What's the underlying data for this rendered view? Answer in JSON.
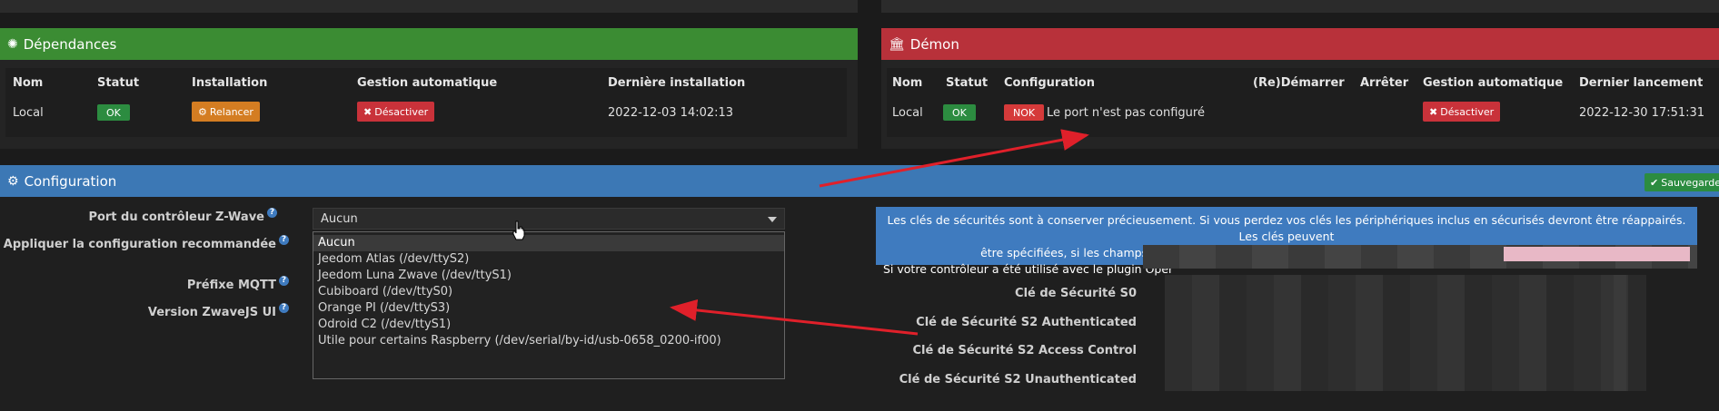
{
  "deps": {
    "title": "Dépendances",
    "headers": [
      "Nom",
      "Statut",
      "Installation",
      "Gestion automatique",
      "Dernière installation"
    ],
    "row": {
      "name": "Local",
      "status": "OK",
      "install_btn": "Relancer",
      "auto_btn": "Désactiver",
      "last": "2022-12-03 14:02:13"
    }
  },
  "daemon": {
    "title": "Démon",
    "headers": [
      "Nom",
      "Statut",
      "Configuration",
      "(Re)Démarrer",
      "Arrêter",
      "Gestion automatique",
      "Dernier lancement"
    ],
    "row": {
      "name": "Local",
      "status": "OK",
      "config_badge": "NOK",
      "config_text": "Le port n'est pas configuré",
      "auto_btn": "Désactiver",
      "last": "2022-12-30 17:51:31"
    }
  },
  "config": {
    "title": "Configuration",
    "save": "Sauvegarder",
    "labels": {
      "port": "Port du contrôleur Z-Wave",
      "apply": "Appliquer la configuration recommandée",
      "mqtt": "Préfixe MQTT",
      "zwavejs": "Version ZwaveJS UI"
    },
    "select_value": "Aucun",
    "options": [
      "Aucun",
      "Jeedom Atlas (/dev/ttyS2)",
      "Jeedom Luna Zwave (/dev/ttyS1)",
      "Cubiboard (/dev/ttyS0)",
      "Orange PI (/dev/ttyS3)",
      "Odroid C2 (/dev/ttyS1)",
      "Utile pour certains Raspberry (/dev/serial/by-id/usb-0658_0200-if00)"
    ],
    "alert_line1": "Les clés de sécurités sont à conserver précieusement. Si vous perdez vos clés les périphériques inclus en sécurisés devront être réappairés. Les clés peuvent",
    "alert_line2": "être spécifiées, si les champs sont vides ou invalides le plugin en générera et vous pourrez les voir ensuite.",
    "alert_line3": "Si votre contrôleur a été utilisé avec le plugin Oper",
    "keys": [
      "Clé de Sécurité S0",
      "Clé de Sécurité S2 Authenticated",
      "Clé de Sécurité S2 Access Control",
      "Clé de Sécurité S2 Unauthenticated"
    ]
  },
  "colors": {
    "green": "#3b8c33",
    "red": "#b8313a",
    "blue": "#3c78b5",
    "arrow": "#e0202a"
  }
}
